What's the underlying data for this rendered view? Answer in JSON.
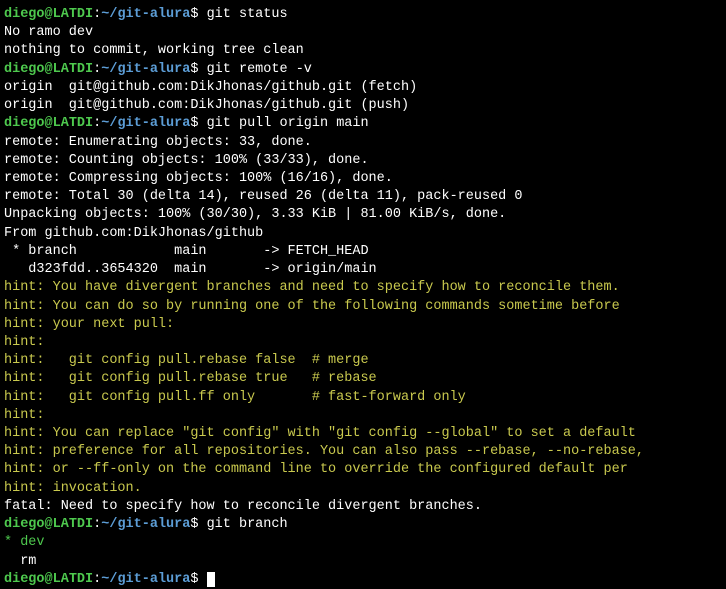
{
  "prompt": {
    "user": "diego",
    "at": "@",
    "host": "LATDI",
    "colon": ":",
    "path": "~/git-alura",
    "dollar": "$ "
  },
  "commands": {
    "status": "git status",
    "remote": "git remote -v",
    "pull": "git pull origin main",
    "branch": "git branch"
  },
  "status_output": {
    "line1": "No ramo dev",
    "line2": "nothing to commit, working tree clean"
  },
  "remote_output": {
    "line1": "origin  git@github.com:DikJhonas/github.git (fetch)",
    "line2": "origin  git@github.com:DikJhonas/github.git (push)"
  },
  "pull_output": {
    "line1": "remote: Enumerating objects: 33, done.",
    "line2": "remote: Counting objects: 100% (33/33), done.",
    "line3": "remote: Compressing objects: 100% (16/16), done.",
    "line4": "remote: Total 30 (delta 14), reused 26 (delta 11), pack-reused 0",
    "line5": "Unpacking objects: 100% (30/30), 3.33 KiB | 81.00 KiB/s, done.",
    "line6": "From github.com:DikJhonas/github",
    "line7": " * branch            main       -> FETCH_HEAD",
    "line8": "   d323fdd..3654320  main       -> origin/main"
  },
  "hints": {
    "h1": "hint: You have divergent branches and need to specify how to reconcile them.",
    "h2": "hint: You can do so by running one of the following commands sometime before",
    "h3": "hint: your next pull:",
    "h4": "hint:",
    "h5": "hint:   git config pull.rebase false  # merge",
    "h6": "hint:   git config pull.rebase true   # rebase",
    "h7": "hint:   git config pull.ff only       # fast-forward only",
    "h8": "hint:",
    "h9": "hint: You can replace \"git config\" with \"git config --global\" to set a default",
    "h10": "hint: preference for all repositories. You can also pass --rebase, --no-rebase,",
    "h11": "hint: or --ff-only on the command line to override the configured default per",
    "h12": "hint: invocation.",
    "fatal": "fatal: Need to specify how to reconcile divergent branches."
  },
  "branch_output": {
    "current": "* dev",
    "other": "  rm"
  }
}
